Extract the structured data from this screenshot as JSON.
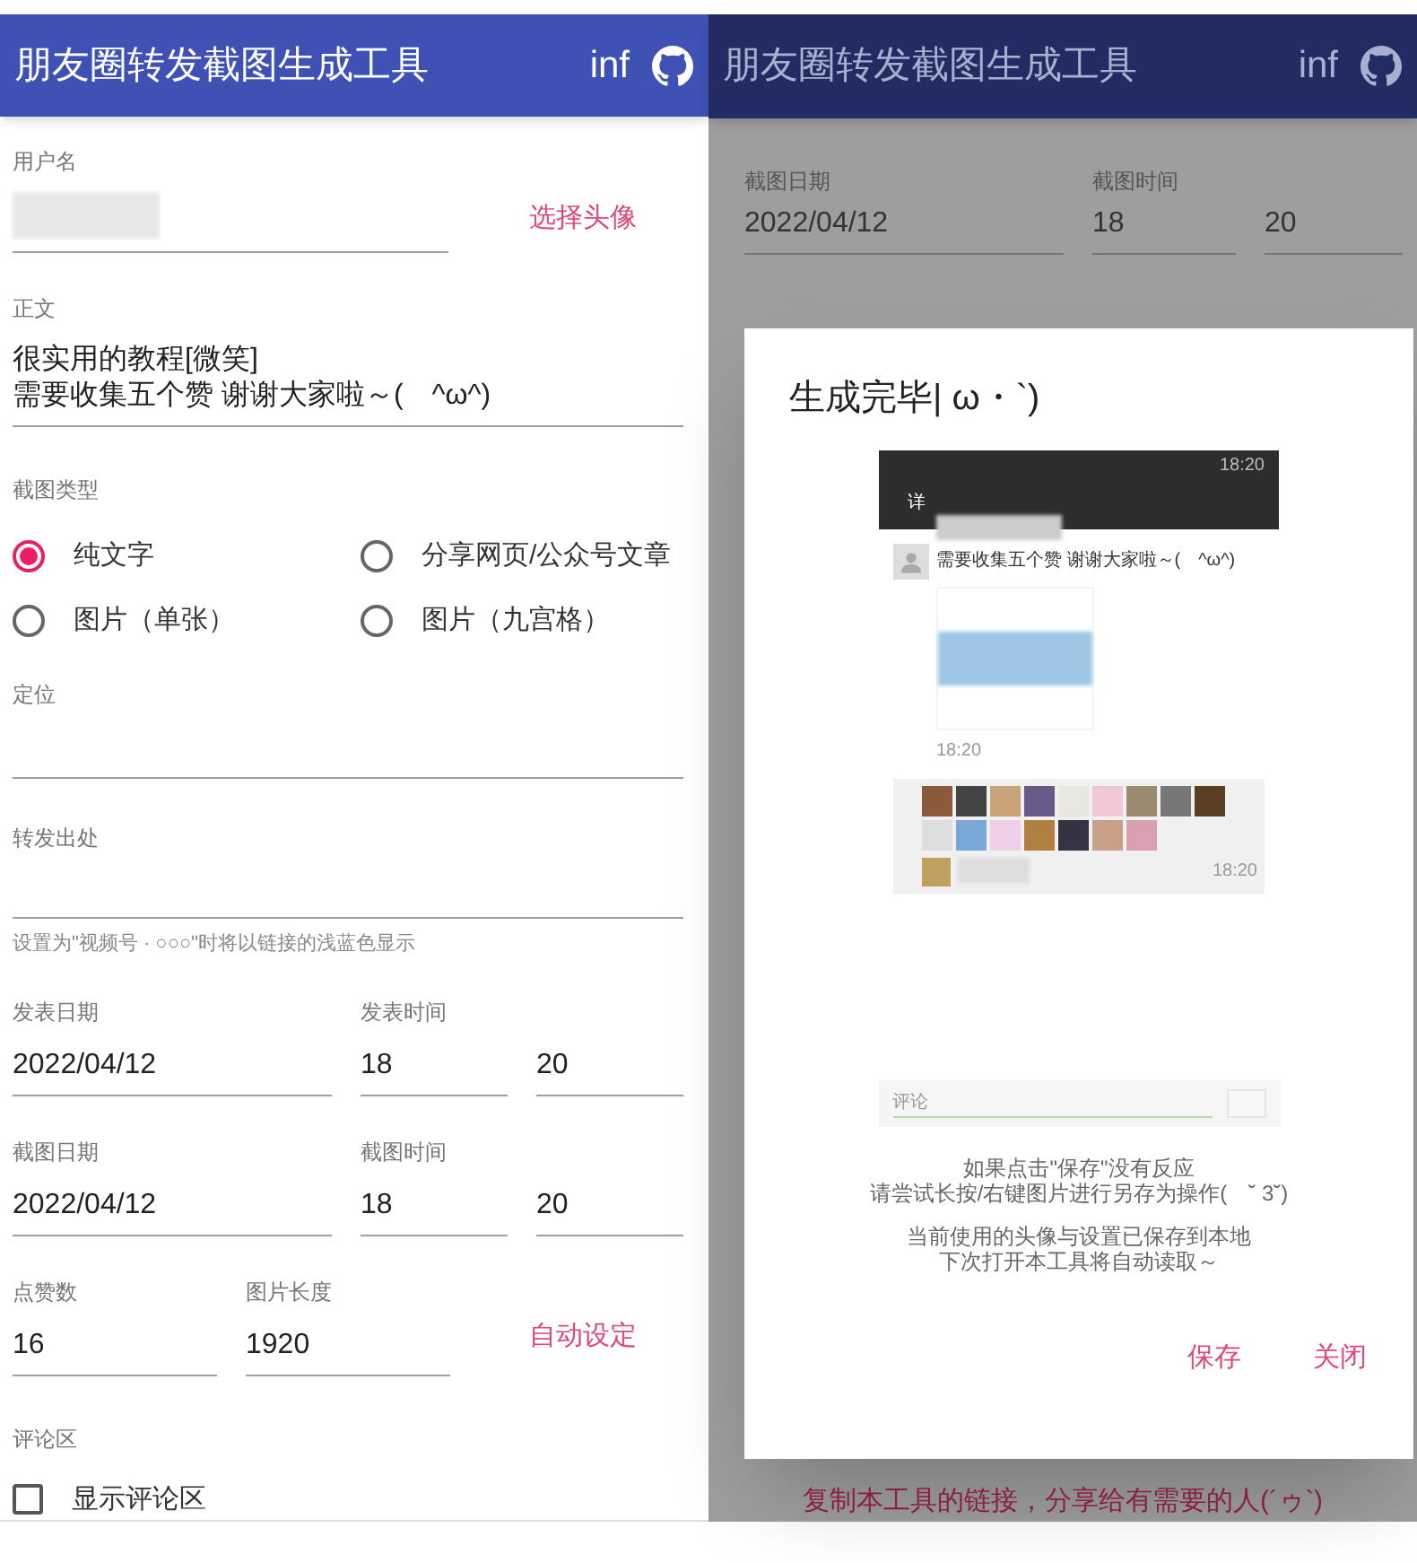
{
  "app_bar": {
    "title": "朋友圈转发截图生成工具",
    "info_label": "inf"
  },
  "form": {
    "username": {
      "label": "用户名",
      "avatar_button": "选择头像"
    },
    "body": {
      "label": "正文",
      "lines": [
        "很实用的教程[微笑]",
        "需要收集五个赞 谢谢大家啦～(　^ω^)"
      ]
    },
    "screenshot_type": {
      "label": "截图类型",
      "options": [
        {
          "label": "纯文字",
          "selected": true
        },
        {
          "label": "分享网页/公众号文章",
          "selected": false
        },
        {
          "label": "图片（单张）",
          "selected": false
        },
        {
          "label": "图片（九宫格）",
          "selected": false
        }
      ]
    },
    "location": {
      "label": "定位"
    },
    "source": {
      "label": "转发出处",
      "helper": "设置为\"视频号 · ○○○\"时将以链接的浅蓝色显示"
    },
    "post_time": {
      "date_label": "发表日期",
      "time_label": "发表时间",
      "date": "2022/04/12",
      "hour": "18",
      "minute": "20"
    },
    "capture_time": {
      "date_label": "截图日期",
      "time_label": "截图时间",
      "date": "2022/04/12",
      "hour": "18",
      "minute": "20"
    },
    "likes": {
      "label": "点赞数",
      "value": "16"
    },
    "image_length": {
      "label": "图片长度",
      "value": "1920",
      "auto_button": "自动设定"
    },
    "comments": {
      "label": "评论区",
      "checkbox_label": "显示评论区",
      "checked": false
    }
  },
  "background_app": {
    "app_bar": {
      "title": "朋友圈转发截图生成工具",
      "info_label": "inf"
    },
    "capture_time": {
      "date_label": "截图日期",
      "time_label": "截图时间",
      "date": "2022/04/12",
      "hour": "18",
      "minute": "20"
    }
  },
  "dialog": {
    "title": "生成完毕| ω・`)",
    "preview": {
      "status_time": "18:20",
      "header_title": "详",
      "post_text": "需要收集五个赞 谢谢大家啦～(　^ω^)",
      "post_time": "18:20",
      "comment_time": "18:20",
      "comment_placeholder": "评论"
    },
    "notes": [
      [
        "如果点击\"保存\"没有反应",
        "请尝试长按/右键图片进行另存为操作(　˘ 3˘)"
      ],
      [
        "当前使用的头像与设置已保存到本地",
        "下次打开本工具将自动读取～"
      ]
    ],
    "buttons": [
      "保存",
      "关闭"
    ]
  },
  "share_text": "复制本工具的链接，分享给有需要的人(´ゥ`)"
}
